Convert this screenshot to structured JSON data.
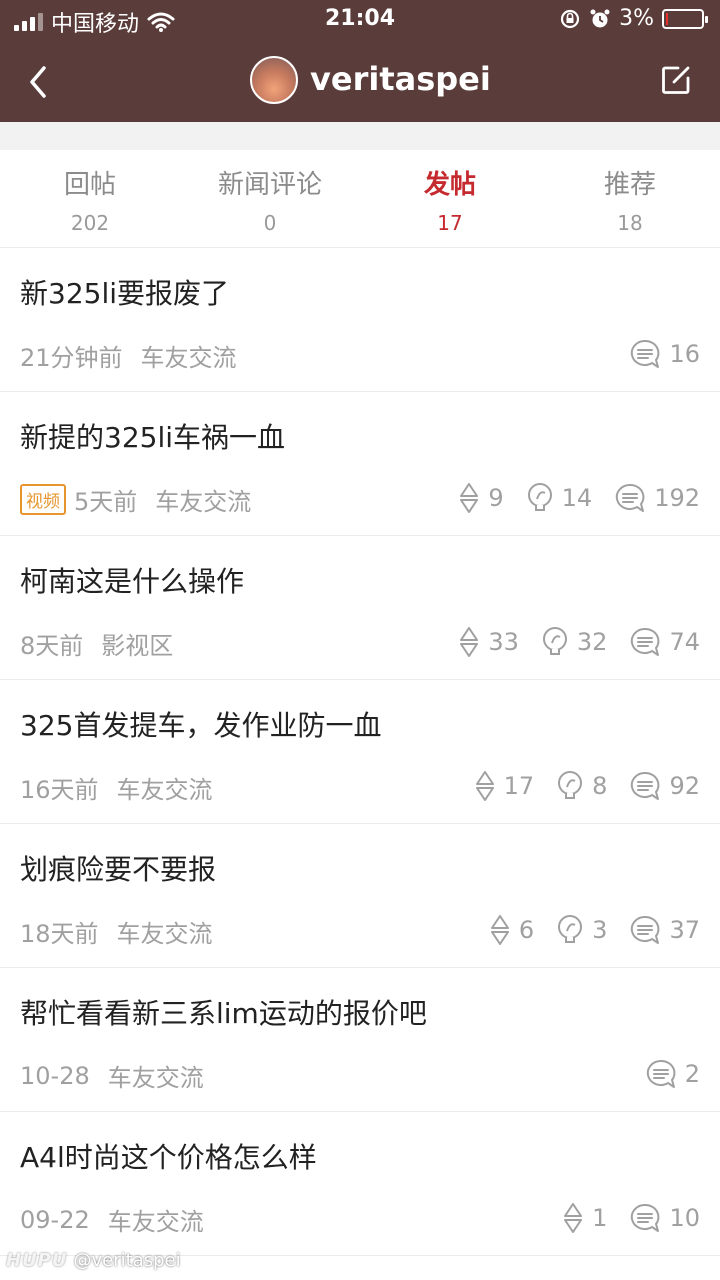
{
  "status_bar": {
    "carrier": "中国移动",
    "time": "21:04",
    "battery": "3%",
    "battery_level": 0.03,
    "icons": [
      "signal-icon",
      "wifi-icon",
      "rotation-lock-icon",
      "alarm-icon",
      "battery-icon"
    ]
  },
  "header": {
    "username": "veritaspei",
    "colors": {
      "background": "#5a3c3a",
      "accent": "#c52a2f"
    }
  },
  "tabs": [
    {
      "label": "回帖",
      "count": "202",
      "active": false
    },
    {
      "label": "新闻评论",
      "count": "0",
      "active": false
    },
    {
      "label": "发帖",
      "count": "17",
      "active": true
    },
    {
      "label": "推荐",
      "count": "18",
      "active": false
    }
  ],
  "posts": [
    {
      "title": "新325li要报废了",
      "badge": "",
      "time": "21分钟前",
      "category": "车友交流",
      "votes": "",
      "lights": "",
      "replies": "16"
    },
    {
      "title": "新提的325li车祸一血",
      "badge": "视频",
      "time": "5天前",
      "category": "车友交流",
      "votes": "9",
      "lights": "14",
      "replies": "192"
    },
    {
      "title": "柯南这是什么操作",
      "badge": "",
      "time": "8天前",
      "category": "影视区",
      "votes": "33",
      "lights": "32",
      "replies": "74"
    },
    {
      "title": "325首发提车，发作业防一血",
      "badge": "",
      "time": "16天前",
      "category": "车友交流",
      "votes": "17",
      "lights": "8",
      "replies": "92"
    },
    {
      "title": "划痕险要不要报",
      "badge": "",
      "time": "18天前",
      "category": "车友交流",
      "votes": "6",
      "lights": "3",
      "replies": "37"
    },
    {
      "title": "帮忙看看新三系lim运动的报价吧",
      "badge": "",
      "time": "10-28",
      "category": "车友交流",
      "votes": "",
      "lights": "",
      "replies": "2"
    },
    {
      "title": "A4l时尚这个价格怎么样",
      "badge": "",
      "time": "09-22",
      "category": "车友交流",
      "votes": "1",
      "lights": "",
      "replies": "10"
    }
  ],
  "watermark": {
    "brand": "HUPU",
    "handle": "@veritaspei"
  }
}
